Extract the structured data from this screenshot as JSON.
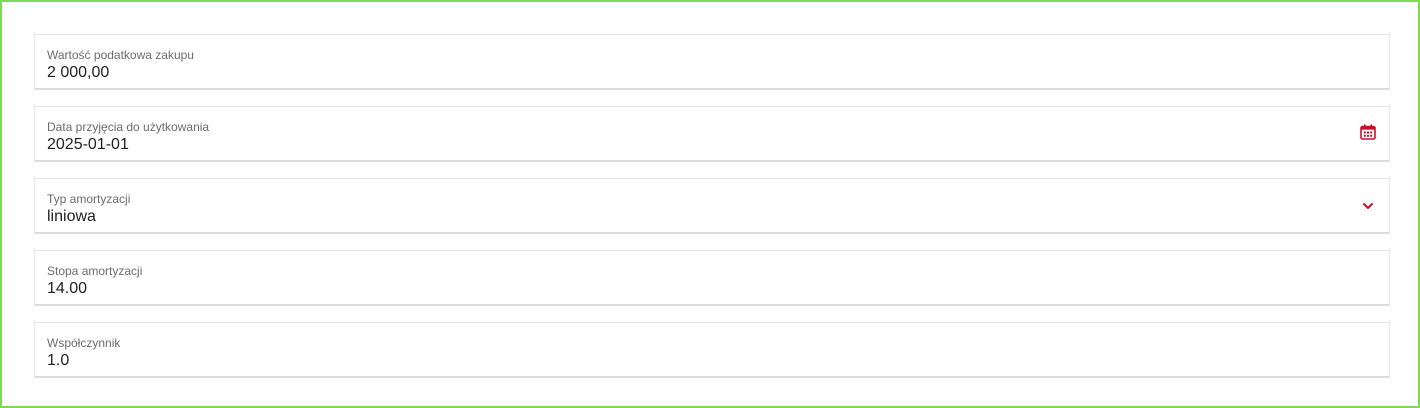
{
  "form": {
    "fields": [
      {
        "label": "Wartość podatkowa zakupu",
        "value": "2 000,00"
      },
      {
        "label": "Data przyjęcia do użytkowania",
        "value": "2025-01-01",
        "icon": "calendar-icon"
      },
      {
        "label": "Typ amortyzacji",
        "value": "liniowa",
        "icon": "chevron-down-icon"
      },
      {
        "label": "Stopa amortyzacji",
        "value": "14.00"
      },
      {
        "label": "Współczynnik",
        "value": "1.0"
      }
    ]
  },
  "colors": {
    "frame_border": "#7ed957",
    "accent_icon": "#c8102e",
    "field_border": "#e6e6e6"
  }
}
